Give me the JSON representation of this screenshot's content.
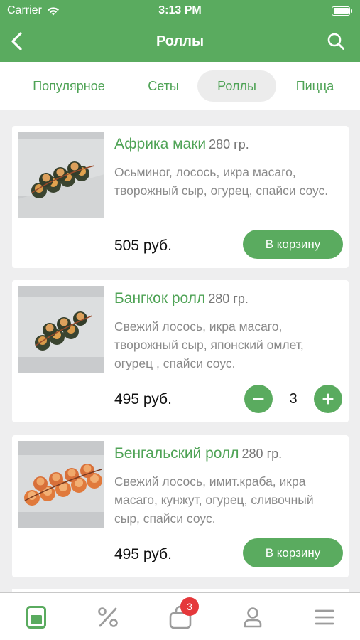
{
  "status_bar": {
    "carrier": "Carrier",
    "time": "3:13 PM"
  },
  "nav": {
    "title": "Роллы",
    "back_icon": "chevron-left-icon",
    "search_icon": "search-icon"
  },
  "tabs": [
    {
      "label": "Популярное",
      "active": false
    },
    {
      "label": "Сеты",
      "active": false
    },
    {
      "label": "Роллы",
      "active": true
    },
    {
      "label": "Пицца",
      "active": false
    }
  ],
  "products": [
    {
      "name": "Африка маки",
      "weight": "280 гр.",
      "description": "Осьминог, лосось, икра масаго, творожный сыр, огурец, спайси соус.",
      "price": "505 руб.",
      "cart_label": "В корзину"
    },
    {
      "name": "Бангкок ролл",
      "weight": "280 гр.",
      "description": "Свежий лосось, икра масаго, творожный сыр, японский омлет, огурец , спайси соус.",
      "price": "495 руб.",
      "quantity": "3"
    },
    {
      "name": "Бенгальский ролл",
      "weight": "280 гр.",
      "description": "Свежий лосось, имит.краба, икра масаго, кунжут, огурец, сливочный сыр, спайси соус.",
      "price": "495 руб.",
      "cart_label": "В корзину"
    }
  ],
  "bottom_bar": {
    "items": [
      "menu-icon",
      "percent-icon",
      "bag-icon",
      "profile-icon",
      "hamburger-icon"
    ],
    "cart_badge": "3"
  },
  "colors": {
    "accent": "#5aab5f",
    "badge": "#e5383b"
  }
}
